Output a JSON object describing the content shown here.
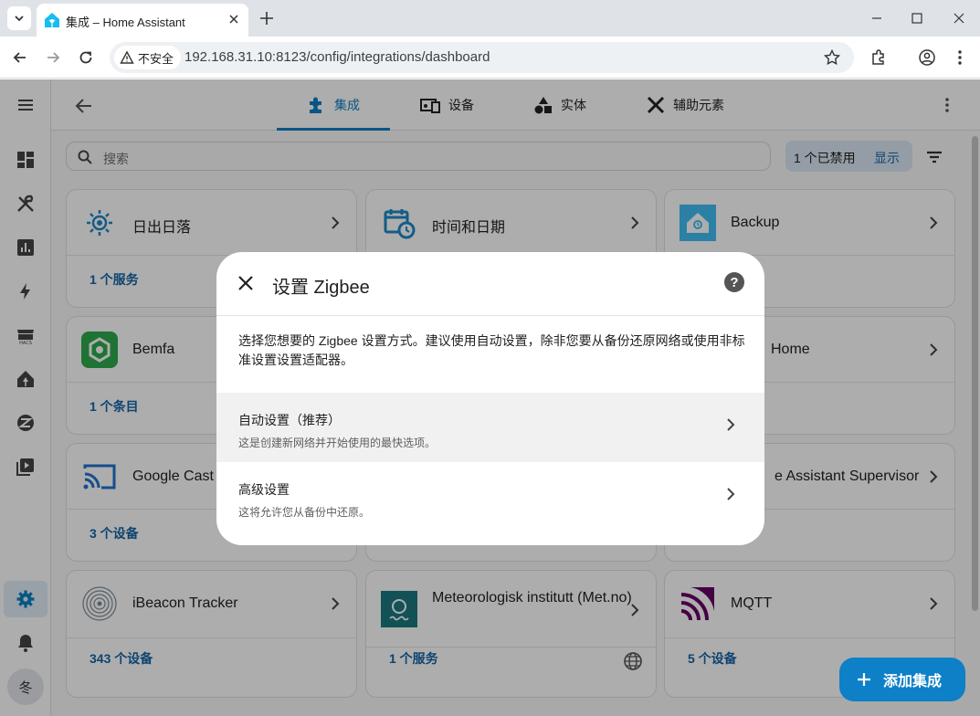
{
  "browser": {
    "tab_title": "集成 – Home Assistant",
    "security_label": "不安全",
    "url": "192.168.31.10:8123/config/integrations/dashboard"
  },
  "topbar": {
    "tabs": [
      {
        "label": "集成",
        "icon": "puzzle-icon",
        "active": true
      },
      {
        "label": "设备",
        "icon": "devices-icon",
        "active": false
      },
      {
        "label": "实体",
        "icon": "shapes-icon",
        "active": false
      },
      {
        "label": "辅助元素",
        "icon": "tools-icon",
        "active": false
      }
    ]
  },
  "search": {
    "placeholder": "搜索"
  },
  "filter_chip": {
    "text": "1 个已禁用",
    "action": "显示"
  },
  "cards": [
    {
      "title": "日出日落",
      "link": "1 个服务"
    },
    {
      "title": "时间和日期",
      "link": ""
    },
    {
      "title": "Backup",
      "link": ""
    },
    {
      "title": "Bemfa",
      "link": "1 个条目"
    },
    {
      "title": "",
      "link": ""
    },
    {
      "title": "Home",
      "link": ""
    },
    {
      "title": "Google Cast",
      "link": "3 个设备"
    },
    {
      "title": "",
      "link": ""
    },
    {
      "title": "e Assistant Supervisor",
      "link": ""
    },
    {
      "title": "iBeacon Tracker",
      "link": "343 个设备"
    },
    {
      "title": "Meteorologisk institutt (Met.no)",
      "link": "1 个服务"
    },
    {
      "title": "MQTT",
      "link": "5 个设备"
    }
  ],
  "fab": {
    "label": "添加集成"
  },
  "user": {
    "avatar_initial": "冬"
  },
  "dialog": {
    "title": "设置 Zigbee",
    "description": "选择您想要的 Zigbee 设置方式。建议使用自动设置，除非您要从备份还原网络或使用非标准设置设置适配器。",
    "options": [
      {
        "title": "自动设置（推荐）",
        "subtitle": "这是创建新网络并开始使用的最快选项。"
      },
      {
        "title": "高级设置",
        "subtitle": "这将允许您从备份中还原。"
      }
    ]
  },
  "colors": {
    "accent": "#0d80c7",
    "link": "#1565a5",
    "scrim": "rgba(0,0,0,0.32)"
  }
}
